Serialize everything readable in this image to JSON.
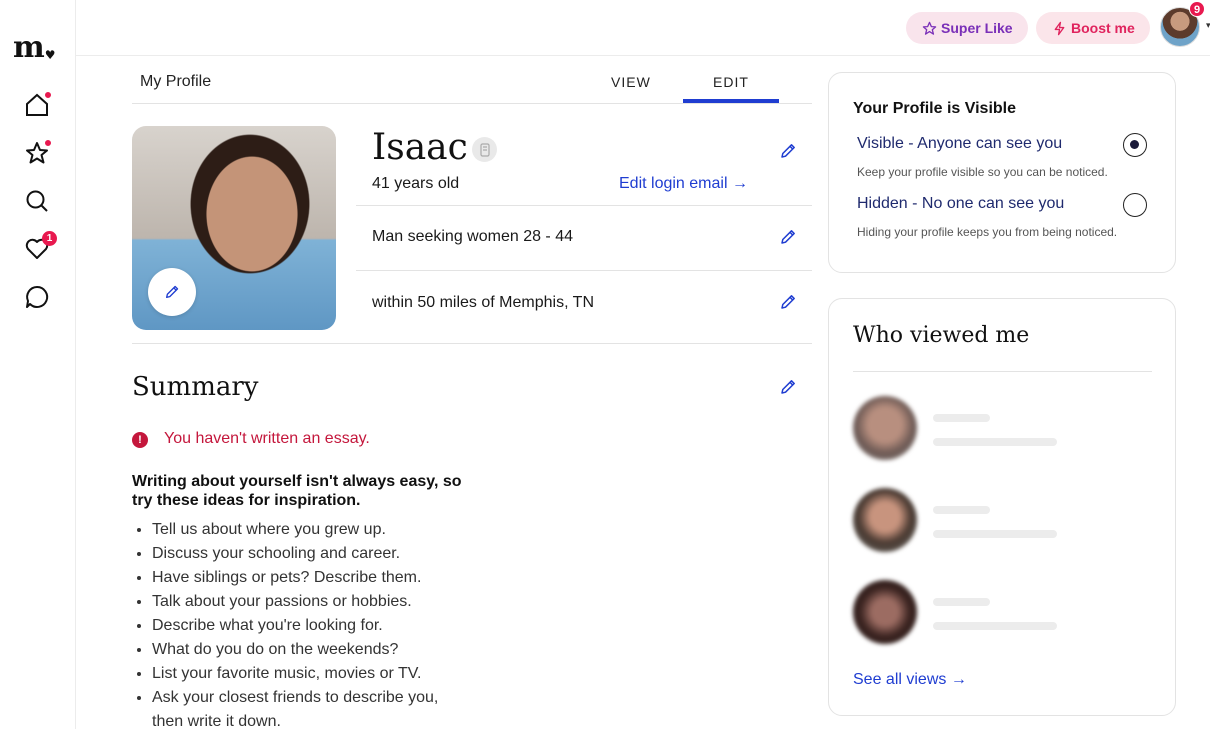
{
  "brand": {
    "logo_text": "m",
    "logo_heart": "♥"
  },
  "nav": {
    "items": [
      {
        "name": "home",
        "icon": "home-icon",
        "badge": "dot"
      },
      {
        "name": "likes",
        "icon": "star-icon",
        "badge": "dot"
      },
      {
        "name": "search",
        "icon": "search-icon",
        "badge": ""
      },
      {
        "name": "matches",
        "icon": "heart-icon",
        "badge": "1"
      },
      {
        "name": "messages",
        "icon": "chat-icon",
        "badge": ""
      }
    ]
  },
  "topbar": {
    "super_like_label": "Super Like",
    "boost_label": "Boost me",
    "avatar_badge": "9",
    "caret": "▾"
  },
  "profile_tabs": {
    "title": "My Profile",
    "view_label": "VIEW",
    "edit_label": "EDIT",
    "active": "EDIT"
  },
  "profile": {
    "name": "Isaac",
    "age": "41 years old",
    "edit_email_label": "Edit login email →",
    "seeking": "Man seeking women 28 - 44",
    "location": "within 50 miles of Memphis, TN"
  },
  "summary": {
    "title": "Summary",
    "warning": "You haven't written an essay.",
    "warning_icon": "!",
    "tips_heading": "Writing about yourself isn't always easy, so try these ideas for inspiration.",
    "tips": [
      "Tell us about where you grew up.",
      "Discuss your schooling and career.",
      "Have siblings or pets? Describe them.",
      "Talk about your passions or hobbies.",
      "Describe what you're looking for.",
      "What do you do on the weekends?",
      "List your favorite music, movies or TV.",
      "Ask your closest friends to describe you, then write it down."
    ]
  },
  "visibility": {
    "title": "Your Profile is Visible",
    "visible_label": "Visible - Anyone can see you",
    "visible_sub": "Keep your profile visible so you can be noticed.",
    "hidden_label": "Hidden - No one can see you",
    "hidden_sub": "Hiding your profile keeps you from being noticed.",
    "selected": "visible"
  },
  "who_viewed": {
    "title": "Who viewed me",
    "viewer_count_shown": 3,
    "see_all_label": "See all views →"
  },
  "colors": {
    "accent_blue": "#1f3dd1",
    "alert_red": "#c4173c",
    "badge_red": "#e8194f",
    "super_like_purple": "#7a2fb8",
    "boost_pink": "#e0245e"
  }
}
